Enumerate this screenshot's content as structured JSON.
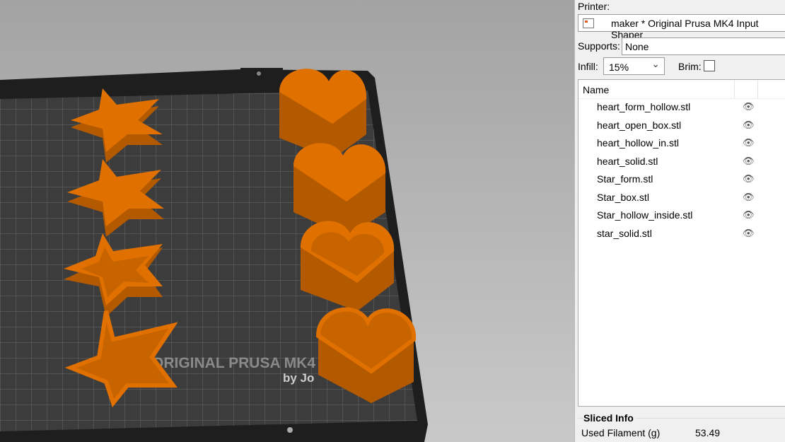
{
  "viewport": {
    "bed_label": "ORIGINAL PRUSA MK4",
    "bed_sublabel": "by Jo",
    "filament_color": "#e07000"
  },
  "panel": {
    "printer_label": "Printer:",
    "printer_value": "maker * Original Prusa MK4 Input Shaper",
    "supports_label": "Supports:",
    "supports_value": "None",
    "infill_label": "Infill:",
    "infill_value": "15%",
    "brim_label": "Brim:",
    "brim_checked": false,
    "list_header": "Name",
    "objects": [
      {
        "name": "heart_form_hollow.stl",
        "icon": "eye-icon"
      },
      {
        "name": "heart_open_box.stl",
        "icon": "eye-icon"
      },
      {
        "name": "heart_hollow_in.stl",
        "icon": "eye-icon"
      },
      {
        "name": "heart_solid.stl",
        "icon": "eye-icon"
      },
      {
        "name": "Star_form.stl",
        "icon": "eye-icon"
      },
      {
        "name": "Star_box.stl",
        "icon": "eye-icon"
      },
      {
        "name": "Star_hollow_inside.stl",
        "icon": "eye-icon"
      },
      {
        "name": "star_solid.stl",
        "icon": "eye-icon"
      }
    ],
    "sliced_info_title": "Sliced Info",
    "used_filament_label": "Used Filament (g)",
    "used_filament_value": "53.49"
  }
}
